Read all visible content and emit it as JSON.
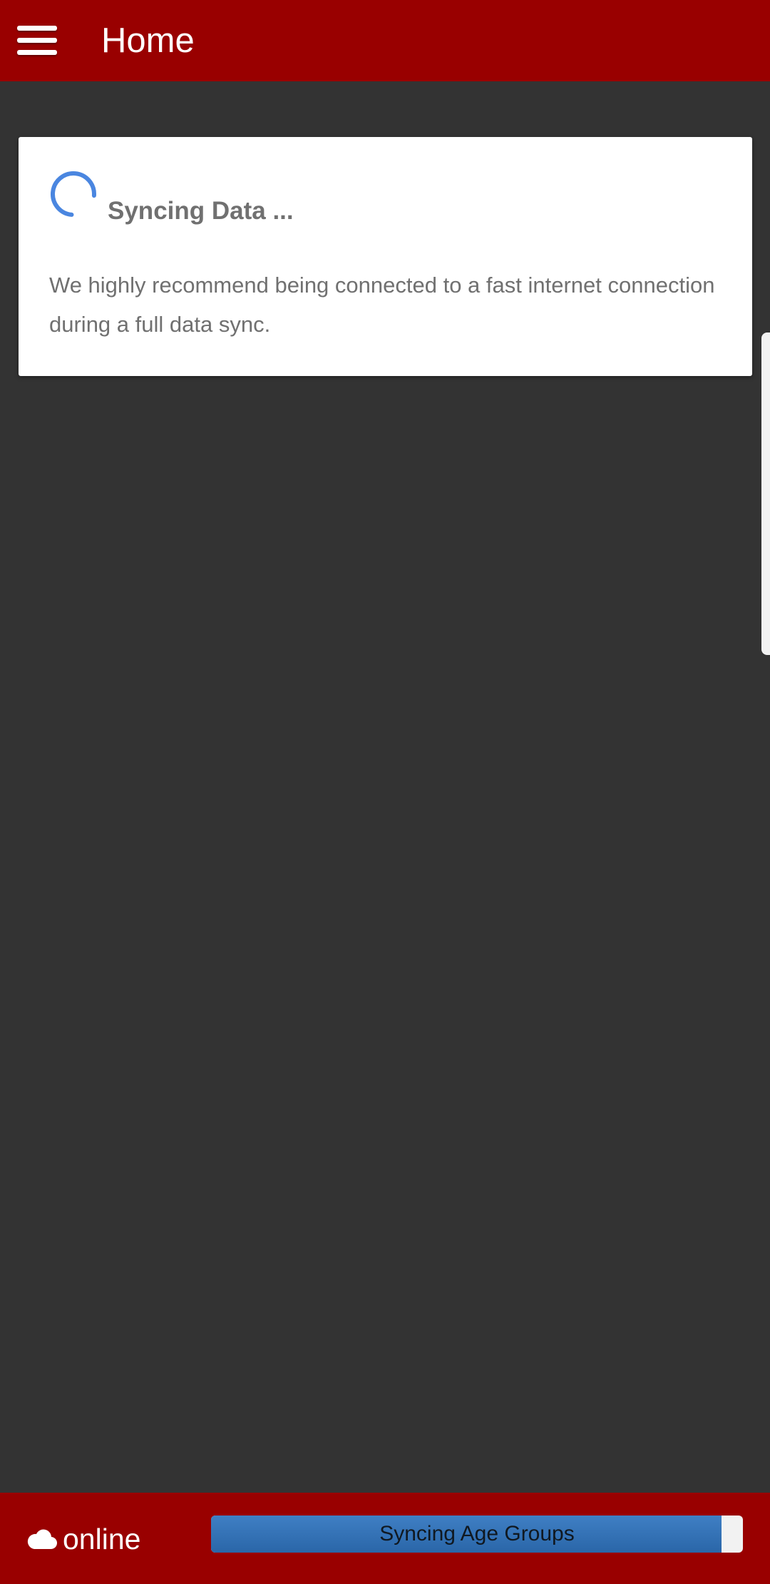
{
  "header": {
    "menu_icon": "hamburger-menu-icon",
    "title": "Home"
  },
  "sync_card": {
    "spinner_icon": "loading-spinner-icon",
    "title": "Syncing Data ...",
    "message": "We highly recommend being connected to a fast internet connection during a full data sync."
  },
  "footer": {
    "status_icon": "cloud-icon",
    "status": "online",
    "progress": {
      "label": "Syncing Age Groups",
      "fraction": 0.96
    }
  },
  "colors": {
    "header_background": "#990000",
    "page_background": "#333333",
    "card_background": "#ffffff",
    "spinner": "#4a86e0",
    "progress_fill": "#2f6eb3",
    "progress_track": "#f2f2f2"
  }
}
